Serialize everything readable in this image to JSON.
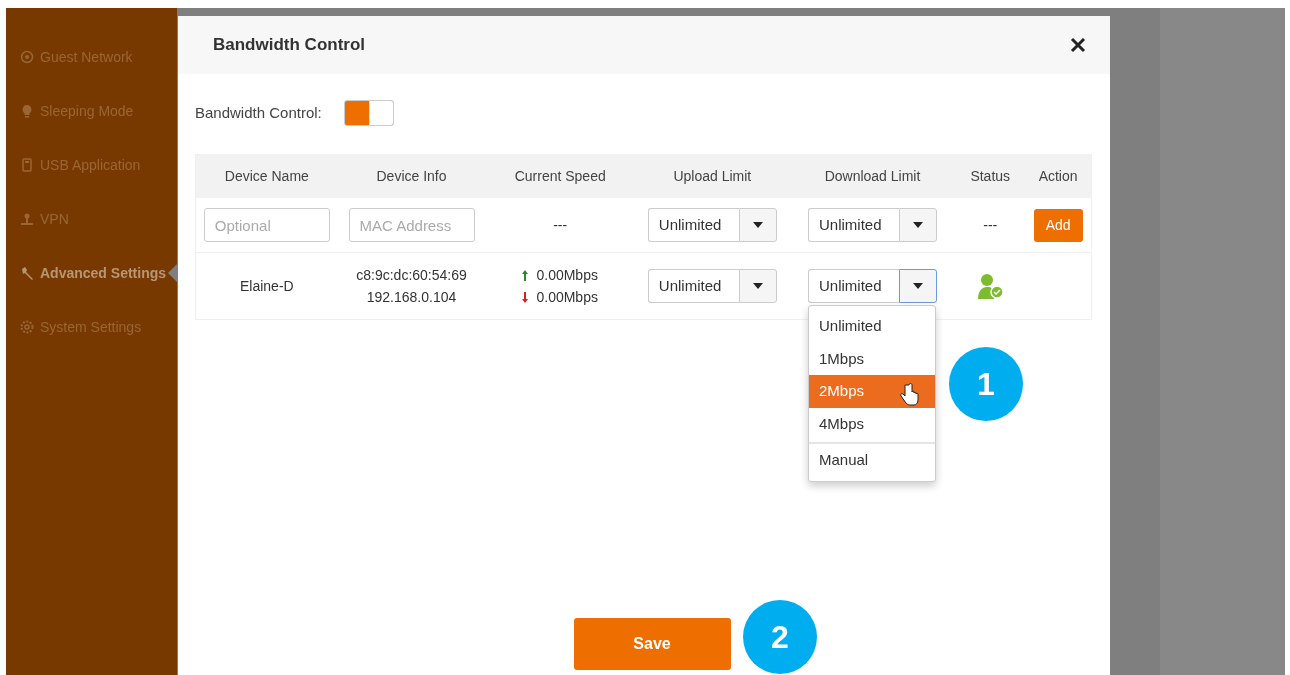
{
  "sidebar": {
    "items": [
      {
        "label": "Guest Network",
        "selected": false
      },
      {
        "label": "Sleeping Mode",
        "selected": false
      },
      {
        "label": "USB Application",
        "selected": false
      },
      {
        "label": "VPN",
        "selected": false
      },
      {
        "label": "Advanced Settings",
        "selected": true
      },
      {
        "label": "System Settings",
        "selected": false
      }
    ]
  },
  "modal": {
    "title": "Bandwidth Control",
    "toggle": {
      "label": "Bandwidth Control:",
      "on": true
    },
    "table": {
      "columns": [
        "Device Name",
        "Device Info",
        "Current Speed",
        "Upload Limit",
        "Download Limit",
        "Status",
        "Action"
      ],
      "new_row": {
        "name_placeholder": "Optional",
        "info_placeholder": "MAC Address",
        "speed": "---",
        "upload": "Unlimited",
        "download": "Unlimited",
        "status": "---",
        "action": "Add"
      },
      "rows": [
        {
          "name": "Elaine-D",
          "mac": "c8:9c:dc:60:54:69",
          "ip": "192.168.0.104",
          "up_speed": "0.00Mbps",
          "down_speed": "0.00Mbps",
          "upload": "Unlimited",
          "download": "Unlimited",
          "online": true,
          "download_open": true,
          "download_options": [
            {
              "label": "Unlimited",
              "selected": false,
              "separated": false
            },
            {
              "label": "1Mbps",
              "selected": false,
              "separated": false
            },
            {
              "label": "2Mbps",
              "selected": true,
              "separated": false
            },
            {
              "label": "4Mbps",
              "selected": false,
              "separated": false
            },
            {
              "label": "Manual",
              "selected": false,
              "separated": true
            }
          ]
        }
      ]
    },
    "save": "Save"
  },
  "callouts": [
    {
      "number": "1"
    },
    {
      "number": "2"
    }
  ]
}
